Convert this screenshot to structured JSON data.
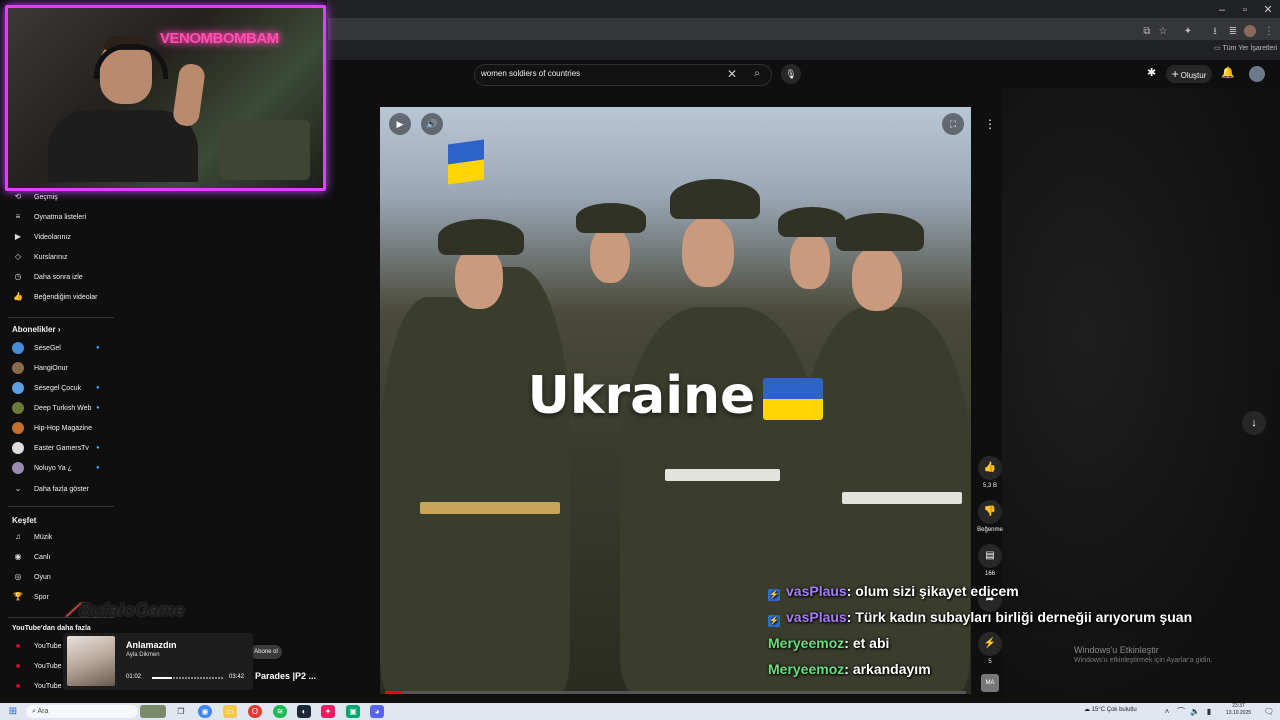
{
  "browser": {
    "bookmarks_label": "Tüm Yer İşaretleri",
    "window_controls": [
      "–",
      "▫",
      "✕"
    ]
  },
  "youtube": {
    "search_query": "women soldiers of countries",
    "create_label": "Oluştur"
  },
  "sidebar": {
    "you_items": [
      {
        "icon": "history-icon",
        "glyph": "⟲",
        "label": "Geçmiş"
      },
      {
        "icon": "playlist-icon",
        "glyph": "≡",
        "label": "Oynatma listeleri"
      },
      {
        "icon": "your-videos-icon",
        "glyph": "▶",
        "label": "Videolarınız"
      },
      {
        "icon": "courses-icon",
        "glyph": "◇",
        "label": "Kurslarınız"
      },
      {
        "icon": "watch-later-icon",
        "glyph": "◷",
        "label": "Daha sonra izle"
      },
      {
        "icon": "liked-icon",
        "glyph": "👍",
        "label": "Beğendiğim videolar"
      }
    ],
    "subs_title": "Abonelikler",
    "subscriptions": [
      {
        "label": "SeseGel",
        "color": "#4a8bd6",
        "dot": true
      },
      {
        "label": "HangiOnur",
        "color": "#8a6a4a",
        "dot": false
      },
      {
        "label": "Sesegel Çocuk",
        "color": "#5aa0e0",
        "dot": true
      },
      {
        "label": "Deep Turkish Web",
        "color": "#6a7a3a",
        "dot": true
      },
      {
        "label": "Hip-Hop Magazine",
        "color": "#c07030",
        "dot": false
      },
      {
        "label": "Easter GamersTv",
        "color": "#dddddd",
        "dot": true
      },
      {
        "label": "Noluyo Ya ¿",
        "color": "#9a8ab0",
        "dot": true
      }
    ],
    "show_more": "Daha fazla göster",
    "explore_title": "Keşfet",
    "explore_items": [
      {
        "icon": "music-icon",
        "glyph": "♫",
        "label": "Müzik"
      },
      {
        "icon": "live-icon",
        "glyph": "◉",
        "label": "Canlı"
      },
      {
        "icon": "gaming-icon",
        "glyph": "◎",
        "label": "Oyun"
      },
      {
        "icon": "sports-icon",
        "glyph": "🏆",
        "label": "Spor"
      }
    ],
    "more_title": "YouTube'dan daha fazla",
    "more_items": [
      "YouTube",
      "YouTube",
      "YouTube"
    ]
  },
  "webcam": {
    "neon_text": "VENOMBOMBAM"
  },
  "video": {
    "caption": "Ukraine",
    "actions": {
      "like_count": "5,3 B",
      "dislike_label": "Beğenme",
      "comment_count": "166",
      "remix_count": "5"
    }
  },
  "chat": [
    {
      "user": "vasPlaus",
      "color": "purple",
      "badge": true,
      "message": ": olum sizi şikayet edicem"
    },
    {
      "user": "vasPlaus",
      "color": "purple",
      "badge": true,
      "message": ": Türk kadın subayları birliği derneğii arıyorum şuan"
    },
    {
      "user": "Meryeemoz",
      "color": "green",
      "badge": false,
      "message": ": et abi"
    },
    {
      "user": "Meryeemoz",
      "color": "green",
      "badge": false,
      "message": ": arkandayım"
    }
  ],
  "music": {
    "title": "Anlamazdın",
    "artist": "Ayla Dikmen",
    "elapsed": "01:02",
    "duration": "03:42",
    "progress": 0.28
  },
  "overlay": {
    "brand_text": "BufaloGame",
    "subscribe_chip": "Abone ol",
    "parades_text": "Parades |P2 ..."
  },
  "watermark": {
    "line1": "Windows'u Etkinleştir",
    "line2": "Windows'u etkinleştirmek için Ayarlar'a gidin."
  },
  "taskbar": {
    "search_placeholder": "Ara",
    "weather": "15°C  Çok bulutlu",
    "time": "23:37",
    "date": "13.10.2025"
  },
  "colors": {
    "youtube_bg": "#0f0f0f",
    "webcam_border": "#e040fb",
    "progress_red": "#ff0000",
    "chat_purple": "#a57cff",
    "chat_green": "#66e07a"
  }
}
